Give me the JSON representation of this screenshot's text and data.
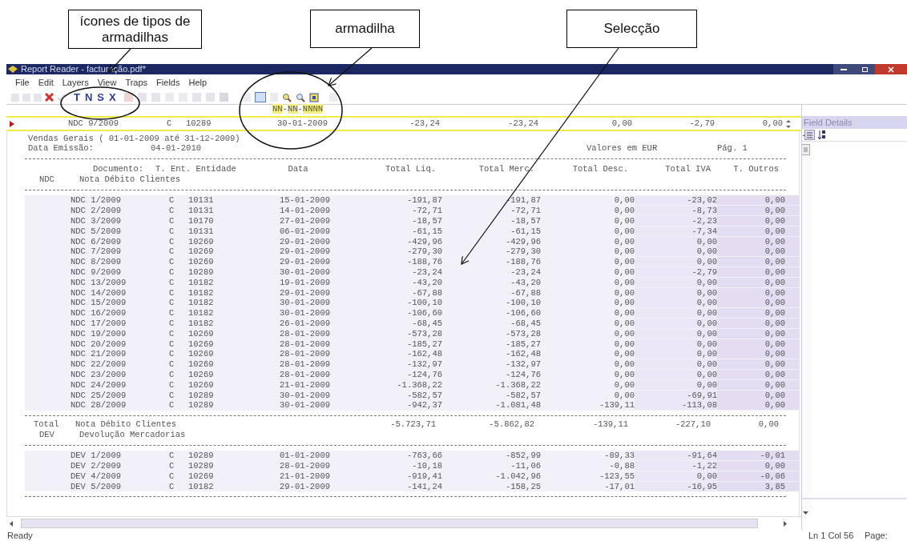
{
  "annotations": [
    {
      "text": "ícones de tipos de armadilhas"
    },
    {
      "text": "armadilha"
    },
    {
      "text": "Selecção"
    }
  ],
  "window": {
    "title": "Report Reader - facturação.pdf*"
  },
  "menu": [
    "File",
    "Edit",
    "Layers",
    "View",
    "Traps",
    "Fields",
    "Help"
  ],
  "trap_types": [
    "T",
    "N",
    "S",
    "X"
  ],
  "trap": {
    "pattern": [
      "NN",
      "-",
      "NN",
      "-",
      "NNNN"
    ]
  },
  "selected_row": {
    "cells": [
      "NDC 9/2009",
      "C",
      "10289",
      "30-01-2009",
      "-23,24",
      "-23,24",
      "0,00",
      "-2,79",
      "0,00"
    ]
  },
  "report": {
    "title": "Vendas Gerais ( 01-01-2009 até 31-12-2009)",
    "emission_label": "Data Emissão:",
    "emission_date": "04-01-2010",
    "currency": "Valores em EUR",
    "page": "Pág. 1",
    "columns": [
      "Documento:",
      "T. Ent. Entidade",
      "Data",
      "Total Liq.",
      "Total Merc.",
      "Total Desc.",
      "Total IVA",
      "T. Outros"
    ],
    "groups": [
      {
        "code": "NDC",
        "name": "Nota Débito Clientes",
        "rows": [
          {
            "selected": true,
            "cells": [
              "NDC 1/2009",
              "C",
              "10131",
              "15-01-2009",
              "-191,87",
              "-191,87",
              "0,00",
              "-23,02",
              "0,00"
            ]
          },
          {
            "selected": true,
            "cells": [
              "NDC 2/2009",
              "C",
              "10131",
              "14-01-2009",
              "-72,71",
              "-72,71",
              "0,00",
              "-8,73",
              "0,00"
            ]
          },
          {
            "selected": true,
            "cells": [
              "NDC 3/2009",
              "C",
              "10170",
              "27-01-2009",
              "-18,57",
              "-18,57",
              "0,00",
              "-2,23",
              "0,00"
            ]
          },
          {
            "selected": true,
            "cells": [
              "NDC 5/2009",
              "C",
              "10131",
              "06-01-2009",
              "-61,15",
              "-61,15",
              "0,00",
              "-7,34",
              "0,00"
            ]
          },
          {
            "selected": true,
            "cells": [
              "NDC 6/2009",
              "C",
              "10269",
              "29-01-2009",
              "-429,96",
              "-429,96",
              "0,00",
              "0,00",
              "0,00"
            ]
          },
          {
            "selected": true,
            "cells": [
              "NDC 7/2009",
              "C",
              "10269",
              "29-01-2009",
              "-279,30",
              "-279,30",
              "0,00",
              "0,00",
              "0,00"
            ]
          },
          {
            "selected": true,
            "cells": [
              "NDC 8/2009",
              "C",
              "10269",
              "29-01-2009",
              "-188,76",
              "-188,76",
              "0,00",
              "0,00",
              "0,00"
            ]
          },
          {
            "selected": true,
            "cells": [
              "NDC 9/2009",
              "C",
              "10289",
              "30-01-2009",
              "-23,24",
              "-23,24",
              "0,00",
              "-2,79",
              "0,00"
            ]
          },
          {
            "selected": true,
            "cells": [
              "NDC 13/2009",
              "C",
              "10182",
              "19-01-2009",
              "-43,20",
              "-43,20",
              "0,00",
              "0,00",
              "0,00"
            ]
          },
          {
            "selected": true,
            "cells": [
              "NDC 14/2009",
              "C",
              "10182",
              "29-01-2009",
              "-67,88",
              "-67,88",
              "0,00",
              "0,00",
              "0,00"
            ]
          },
          {
            "selected": true,
            "cells": [
              "NDC 15/2009",
              "C",
              "10182",
              "30-01-2009",
              "-100,10",
              "-100,10",
              "0,00",
              "0,00",
              "0,00"
            ]
          },
          {
            "selected": true,
            "cells": [
              "NDC 16/2009",
              "C",
              "10182",
              "30-01-2009",
              "-106,60",
              "-106,60",
              "0,00",
              "0,00",
              "0,00"
            ]
          },
          {
            "selected": true,
            "cells": [
              "NDC 17/2009",
              "C",
              "10182",
              "26-01-2009",
              "-68,45",
              "-68,45",
              "0,00",
              "0,00",
              "0,00"
            ]
          },
          {
            "selected": true,
            "cells": [
              "NDC 19/2009",
              "C",
              "10269",
              "28-01-2009",
              "-573,28",
              "-573,28",
              "0,00",
              "0,00",
              "0,00"
            ]
          },
          {
            "selected": true,
            "cells": [
              "NDC 20/2009",
              "C",
              "10269",
              "28-01-2009",
              "-185,27",
              "-185,27",
              "0,00",
              "0,00",
              "0,00"
            ]
          },
          {
            "selected": true,
            "cells": [
              "NDC 21/2009",
              "C",
              "10269",
              "28-01-2009",
              "-162,48",
              "-162,48",
              "0,00",
              "0,00",
              "0,00"
            ]
          },
          {
            "selected": true,
            "cells": [
              "NDC 22/2009",
              "C",
              "10269",
              "28-01-2009",
              "-132,97",
              "-132,97",
              "0,00",
              "0,00",
              "0,00"
            ]
          },
          {
            "selected": true,
            "cells": [
              "NDC 23/2009",
              "C",
              "10269",
              "28-01-2009",
              "-124,76",
              "-124,76",
              "0,00",
              "0,00",
              "0,00"
            ]
          },
          {
            "selected": true,
            "cells": [
              "NDC 24/2009",
              "C",
              "10269",
              "21-01-2009",
              "-1.368,22",
              "-1.368,22",
              "0,00",
              "0,00",
              "0,00"
            ]
          },
          {
            "selected": true,
            "cells": [
              "NDC 25/2009",
              "C",
              "10289",
              "30-01-2009",
              "-582,57",
              "-582,57",
              "0,00",
              "-69,91",
              "0,00"
            ]
          },
          {
            "selected": true,
            "cells": [
              "NDC 28/2009",
              "C",
              "10289",
              "30-01-2009",
              "-942,37",
              "-1.081,48",
              "-139,11",
              "-113,08",
              "0,00"
            ]
          }
        ],
        "total": {
          "label": "Total",
          "name": "Nota Débito Clientes",
          "values": [
            "-5.723,71",
            "-5.862,82",
            "-139,11",
            "-227,10",
            "0,00"
          ]
        }
      },
      {
        "code": "DEV",
        "name": "Devolução Mercadorias",
        "rows": [
          {
            "selected": true,
            "cells": [
              "DEV 1/2009",
              "C",
              "10289",
              "01-01-2009",
              "-763,66",
              "-852,99",
              "-89,33",
              "-91,64",
              "-0,01"
            ]
          },
          {
            "selected": true,
            "cells": [
              "DEV 2/2009",
              "C",
              "10289",
              "28-01-2009",
              "-10,18",
              "-11,06",
              "-0,88",
              "-1,22",
              "0,00"
            ]
          },
          {
            "selected": true,
            "cells": [
              "DEV 4/2009",
              "C",
              "10269",
              "21-01-2009",
              "-919,41",
              "-1.042,96",
              "-123,55",
              "0,00",
              "-0,06"
            ]
          },
          {
            "selected": true,
            "cells": [
              "DEV 5/2009",
              "C",
              "10182",
              "29-01-2009",
              "-141,24",
              "-158,25",
              "-17,01",
              "-16,95",
              "3,85"
            ]
          }
        ]
      }
    ]
  },
  "field_details": {
    "title": "Field Details"
  },
  "status_bar": {
    "state": "Ready",
    "position": "Ln 1 Col 56",
    "page": "Page:"
  }
}
